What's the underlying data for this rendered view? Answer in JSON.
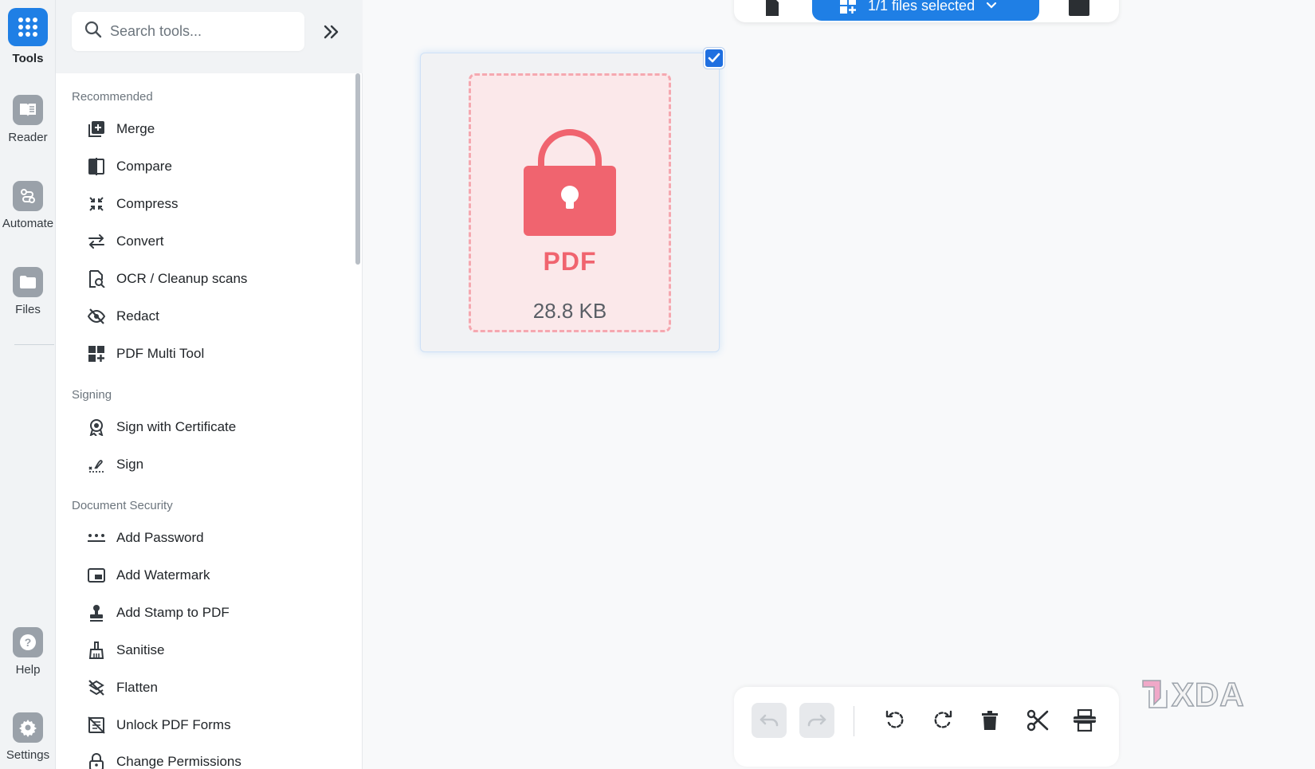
{
  "rail": {
    "items": [
      {
        "label": "Tools",
        "icon": "grid-icon"
      },
      {
        "label": "Reader",
        "icon": "book-icon"
      },
      {
        "label": "Automate",
        "icon": "automate-icon"
      },
      {
        "label": "Files",
        "icon": "folder-icon"
      },
      {
        "label": "Help",
        "icon": "help-icon"
      },
      {
        "label": "Settings",
        "icon": "gear-icon"
      }
    ]
  },
  "search": {
    "placeholder": "Search tools..."
  },
  "sections": {
    "recommended": {
      "title": "Recommended",
      "tools": [
        "Merge",
        "Compare",
        "Compress",
        "Convert",
        "OCR / Cleanup scans",
        "Redact",
        "PDF Multi Tool"
      ]
    },
    "signing": {
      "title": "Signing",
      "tools": [
        "Sign with Certificate",
        "Sign"
      ]
    },
    "security": {
      "title": "Document Security",
      "tools": [
        "Add Password",
        "Add Watermark",
        "Add Stamp to PDF",
        "Sanitise",
        "Flatten",
        "Unlock PDF Forms",
        "Change Permissions"
      ]
    }
  },
  "topbar": {
    "files_selected": "1/1 files selected"
  },
  "file": {
    "type_label": "PDF",
    "size": "28.8 KB",
    "selected": true
  },
  "watermark": {
    "text": "XDA"
  },
  "colors": {
    "accent": "#1f7fe5",
    "pdf_red": "#f0646f"
  }
}
